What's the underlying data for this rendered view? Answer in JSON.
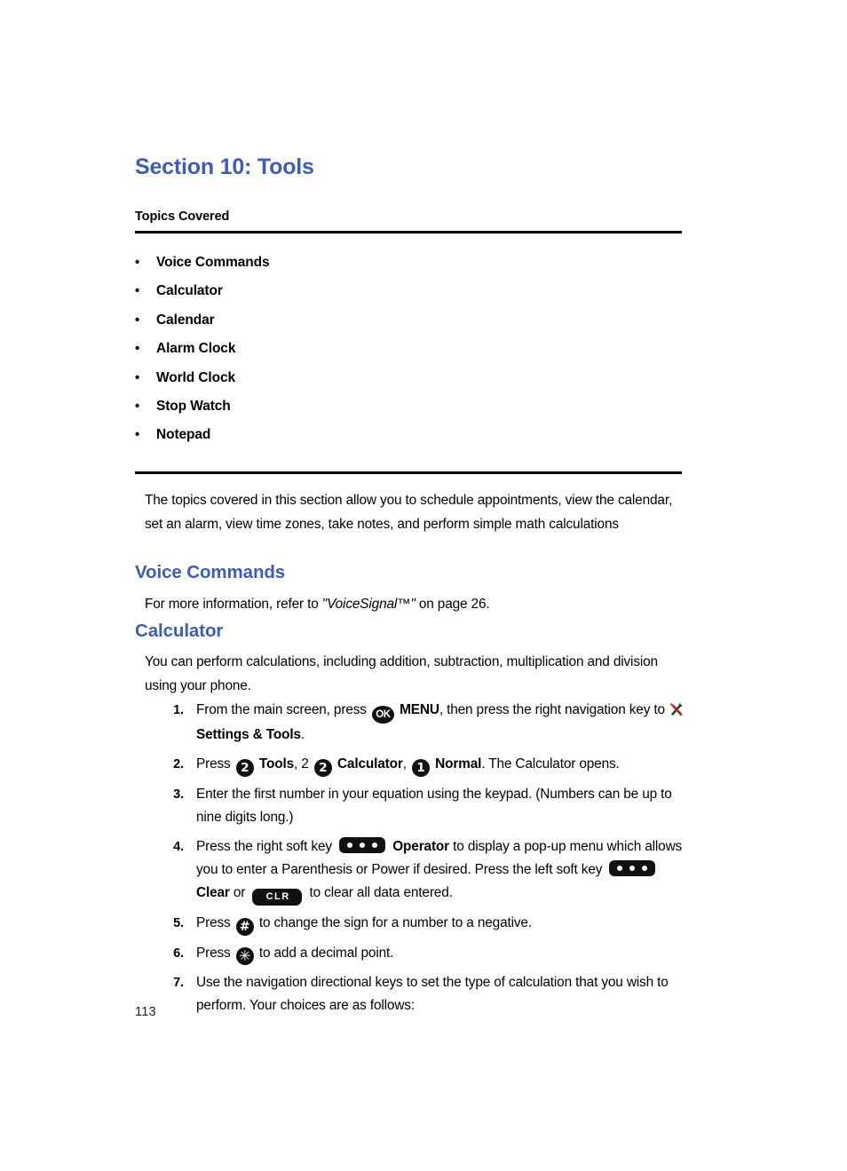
{
  "document": {
    "section_title": "Section 10: Tools",
    "topics_label": "Topics Covered",
    "page_number": "113",
    "heading_color": "#3d5cbb",
    "rule_color": "#000000"
  },
  "topics": [
    {
      "label": "Voice Commands"
    },
    {
      "label": "Calculator"
    },
    {
      "label": "Calendar"
    },
    {
      "label": "Alarm Clock"
    },
    {
      "label": "World Clock"
    },
    {
      "label": "Stop Watch"
    },
    {
      "label": "Notepad"
    }
  ],
  "bullet_glyph": "•",
  "intro": {
    "text": "The topics covered in this section allow you to schedule appointments, view the calendar, set an alarm, view time zones, take notes, and perform simple math calculations"
  },
  "voice_commands": {
    "heading": "Voice Commands",
    "body_prefix": "For more information, refer to ",
    "reference": "\"VoiceSignal™\"",
    "body_suffix": " on page 26."
  },
  "calculator": {
    "heading": "Calculator",
    "intro": "You can perform calculations, including addition, subtraction, multiplication and division using your phone.",
    "steps": [
      {
        "number": "1.",
        "seg1": "From the main screen, press ",
        "icon_ok": "OK",
        "seg2_bold": "MENU",
        "seg3": ", then press the right navigation key to ",
        "icon_tools": "settings-and-tools-icon",
        "seg4_bold": "Settings & Tools",
        "seg5": "."
      },
      {
        "number": "2.",
        "seg1": "Press ",
        "key_a": "2",
        "seg2_bold": "Tools",
        "seg3": ", 2 ",
        "key_b": "2",
        "seg4_bold": "Calculator",
        "seg5": ", ",
        "key_c": "1",
        "seg6_bold": "Normal",
        "seg7": ". The Calculator opens."
      },
      {
        "number": "3.",
        "text": "Enter the first number in your equation using the keypad. (Numbers can be up to nine digits long.)"
      },
      {
        "number": "4.",
        "seg1": "Press the right soft key ",
        "softkey_right": "soft-key-icon",
        "seg2_bold": "Operator",
        "seg3": " to display a pop-up menu which allows you to enter a Parenthesis or Power if desired. Press the left soft key ",
        "softkey_left": "soft-key-icon",
        "seg4_bold": "Clear",
        "seg5": " or ",
        "key_clr": "CLR",
        "seg6": " to clear all data entered."
      },
      {
        "number": "5.",
        "seg1": "Press ",
        "key": "#",
        "seg2": " to change the sign for a number to a negative."
      },
      {
        "number": "6.",
        "seg1": "Press ",
        "key": "✳",
        "seg2": " to add a decimal point."
      },
      {
        "number": "7.",
        "text": "Use the navigation directional keys to set the type of calculation that you wish to perform. Your choices are as follows:"
      }
    ]
  }
}
